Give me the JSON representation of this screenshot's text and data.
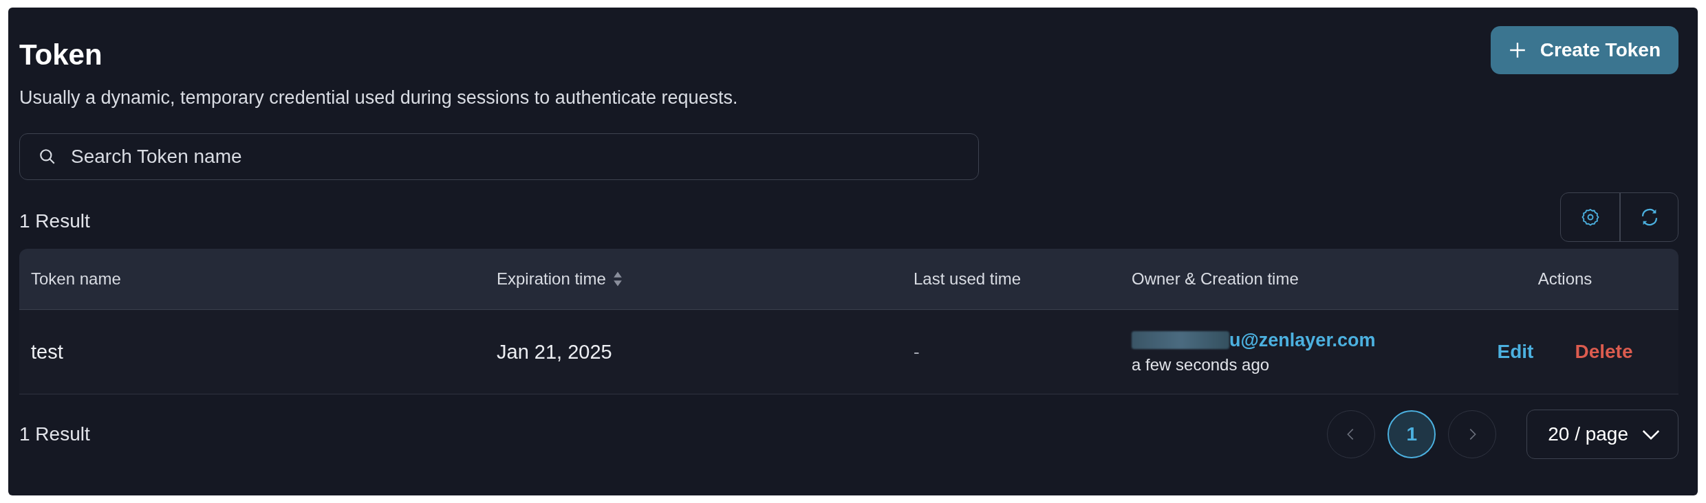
{
  "header": {
    "title": "Token",
    "description": "Usually a dynamic, temporary credential used during sessions to authenticate requests.",
    "create_button": "Create Token"
  },
  "search": {
    "placeholder": "Search Token name"
  },
  "result_count_top": "1 Result",
  "table": {
    "columns": [
      {
        "label": "Token name",
        "sortable": false
      },
      {
        "label": "Expiration time",
        "sortable": true
      },
      {
        "label": "Last used time",
        "sortable": false
      },
      {
        "label": "Owner & Creation time",
        "sortable": false
      },
      {
        "label": "Actions",
        "sortable": false
      }
    ],
    "rows": [
      {
        "name": "test",
        "expiration": "Jan 21, 2025",
        "last_used": "-",
        "owner": "u@zenlayer.com",
        "owner_blurred": true,
        "created": "a few seconds ago",
        "actions": [
          {
            "label": "Edit",
            "kind": "edit"
          },
          {
            "label": "Delete",
            "kind": "delete"
          }
        ]
      }
    ]
  },
  "result_count_bottom": "1 Result",
  "pagination": {
    "prev_disabled": true,
    "next_disabled": true,
    "pages": [
      {
        "label": "1",
        "selected": true
      }
    ],
    "page_size": "20 / page"
  }
}
